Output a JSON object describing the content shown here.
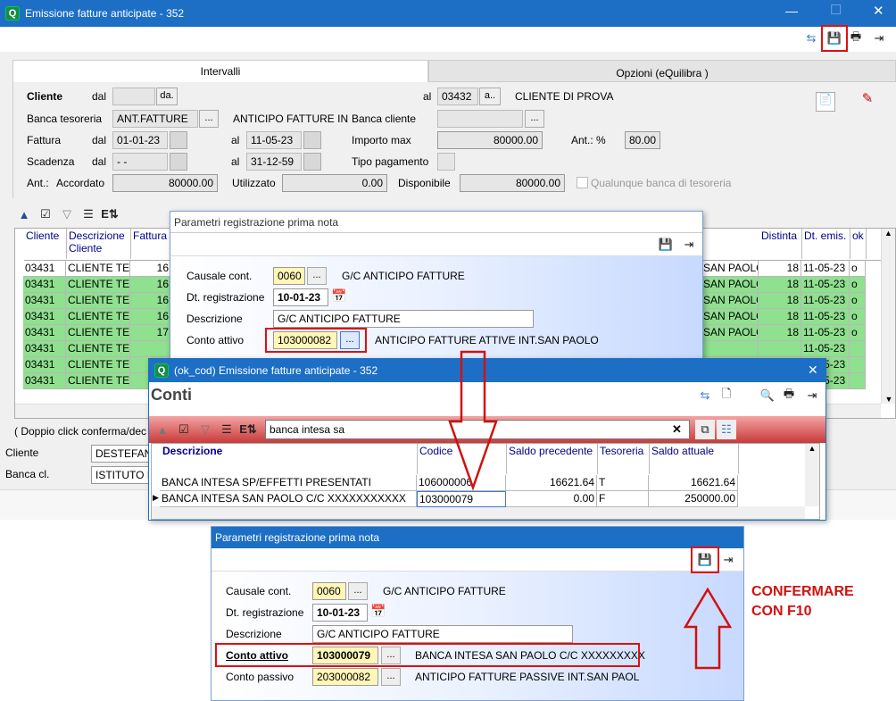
{
  "main": {
    "title": "Emissione fatture anticipate - 352",
    "tab_intervalli": "Intervalli",
    "tab_opzioni": "Opzioni (eQuilibra )",
    "labels": {
      "cliente": "Cliente",
      "dal": "dal",
      "al": "al",
      "banca_tesoreria": "Banca tesoreria",
      "banca_cliente": "Banca cliente",
      "fattura": "Fattura",
      "importo_max": "Importo max",
      "ant_pct": "Ant.: %",
      "scadenza": "Scadenza",
      "tipo_pagamento": "Tipo pagamento",
      "ant": "Ant.:",
      "accordato": "Accordato",
      "utilizzato": "Utilizzato",
      "disponibile": "Disponibile",
      "qualunque": "Qualunque banca di tesoreria"
    },
    "values": {
      "cliente_da_btn": "da.",
      "cliente_a": "03432",
      "cliente_a_btn": "a..",
      "cliente_desc": "CLIENTE DI PROVA",
      "banca_tes": "ANT.FATTURE",
      "banca_tes_desc": "ANTICIPO FATTURE IN",
      "fattura_dal": "01-01-23",
      "fattura_al": "11-05-23",
      "importo_max": "80000.00",
      "ant_pct": "80.00",
      "scad_dal": "- -",
      "scad_al": "31-12-59",
      "accordato": "80000.00",
      "utilizzato": "0.00",
      "disponibile": "80000.00"
    },
    "grid_headers": {
      "cliente": "Cliente",
      "descrizione": "Descrizione Cliente",
      "fattura": "Fattura",
      "distinta": "Distinta",
      "dt_emis": "Dt. emis.",
      "ok": "ok"
    },
    "grid_rows": [
      {
        "cliente": "03431",
        "desc": "CLIENTE TE",
        "fattura": "16",
        "banca": "SAN PAOLO",
        "distinta": "18",
        "dt": "11-05-23",
        "ok": "o"
      },
      {
        "cliente": "03431",
        "desc": "CLIENTE TE",
        "fattura": "16",
        "banca": "SAN PAOLO",
        "distinta": "18",
        "dt": "11-05-23",
        "ok": "o"
      },
      {
        "cliente": "03431",
        "desc": "CLIENTE TE",
        "fattura": "16",
        "banca": "SAN PAOLO",
        "distinta": "18",
        "dt": "11-05-23",
        "ok": "o"
      },
      {
        "cliente": "03431",
        "desc": "CLIENTE TE",
        "fattura": "16",
        "banca": "SAN PAOLO",
        "distinta": "18",
        "dt": "11-05-23",
        "ok": "o"
      },
      {
        "cliente": "03431",
        "desc": "CLIENTE TE",
        "fattura": "17",
        "banca": "SAN PAOLO",
        "distinta": "18",
        "dt": "11-05-23",
        "ok": "o"
      },
      {
        "cliente": "03431",
        "desc": "CLIENTE TE",
        "fattura": "",
        "banca": "",
        "distinta": "",
        "dt": "11-05-23",
        "ok": ""
      },
      {
        "cliente": "03431",
        "desc": "CLIENTE TE",
        "fattura": "",
        "banca": "",
        "distinta": "",
        "dt": "11-05-23",
        "ok": ""
      },
      {
        "cliente": "03431",
        "desc": "CLIENTE TE",
        "fattura": "",
        "banca": "",
        "distinta": "",
        "dt": "11-05-23",
        "ok": ""
      }
    ],
    "footer_hint": "( Doppio click conferma/dec",
    "footer_cliente_label": "Cliente",
    "footer_cliente_value": "DESTEFAN",
    "footer_banca_label": "Banca cl.",
    "footer_banca_value": "ISTITUTO I"
  },
  "dlg1": {
    "title": "Parametri registrazione prima nota",
    "causale_label": "Causale cont.",
    "causale": "0060",
    "causale_desc": "G/C ANTICIPO FATTURE",
    "dtreg_label": "Dt. registrazione",
    "dtreg": "10-01-23",
    "descr_label": "Descrizione",
    "descr": "G/C ANTICIPO FATTURE",
    "conto_label": "Conto attivo",
    "conto": "103000082",
    "conto_desc": "ANTICIPO FATTURE ATTIVE INT.SAN PAOLO"
  },
  "conti": {
    "title": "(ok_cod) Emissione fatture anticipate - 352",
    "heading": "Conti",
    "search": "banca intesa sa",
    "headers": {
      "descrizione": "Descrizione",
      "codice": "Codice",
      "saldo_prec": "Saldo precedente",
      "tesoreria": "Tesoreria",
      "saldo_att": "Saldo attuale"
    },
    "rows": [
      {
        "desc": "BANCA INTESA SP/EFFETTI PRESENTATI",
        "cod": "106000006",
        "sp": "16621.64",
        "tes": "T",
        "sa": "16621.64"
      },
      {
        "desc": "BANCA INTESA SAN PAOLO C/C XXXXXXXXXXX",
        "cod": "103000079",
        "sp": "0.00",
        "tes": "F",
        "sa": "250000.00"
      }
    ]
  },
  "dlg2": {
    "title": "Parametri registrazione prima nota",
    "causale_label": "Causale cont.",
    "causale": "0060",
    "causale_desc": "G/C ANTICIPO FATTURE",
    "dtreg_label": "Dt. registrazione",
    "dtreg": "10-01-23",
    "descr_label": "Descrizione",
    "descr": "G/C ANTICIPO FATTURE",
    "conto_label": "Conto attivo",
    "conto": "103000079",
    "conto_desc": "BANCA INTESA SAN PAOLO C/C XXXXXXXXX",
    "passivo_label": "Conto passivo",
    "passivo": "203000082",
    "passivo_desc": "ANTICIPO FATTURE PASSIVE INT.SAN PAOL"
  },
  "annotation": {
    "line1": "CONFERMARE",
    "line2": "CON F10"
  },
  "colors": {
    "title_blue": "#1d6fc5",
    "row_green": "#8fe08f",
    "annot_red": "#d11111"
  }
}
